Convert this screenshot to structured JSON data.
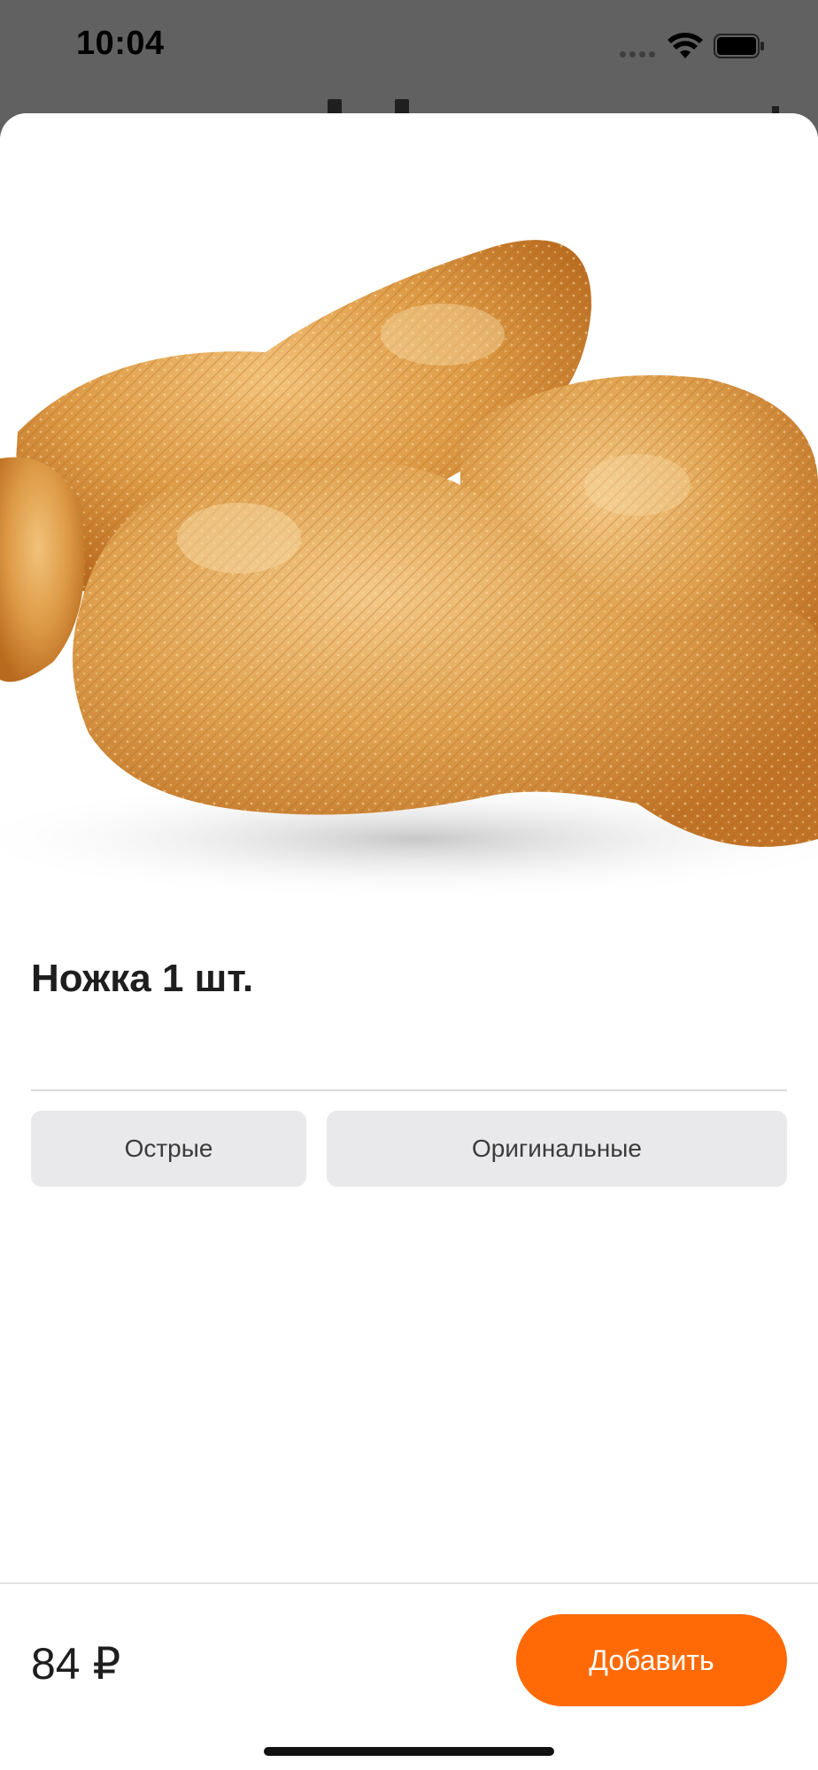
{
  "status_bar": {
    "time": "10:04"
  },
  "product": {
    "image_icon": "fried-chicken-drumsticks-photo",
    "title": "Ножка 1 шт."
  },
  "options": [
    {
      "label": "Острые"
    },
    {
      "label": "Оригинальные"
    }
  ],
  "footer": {
    "price": "84 ₽",
    "add_label": "Добавить"
  },
  "colors": {
    "accent": "#ff6a07",
    "option_bg": "#e9e9eb",
    "backdrop": "#616161"
  }
}
